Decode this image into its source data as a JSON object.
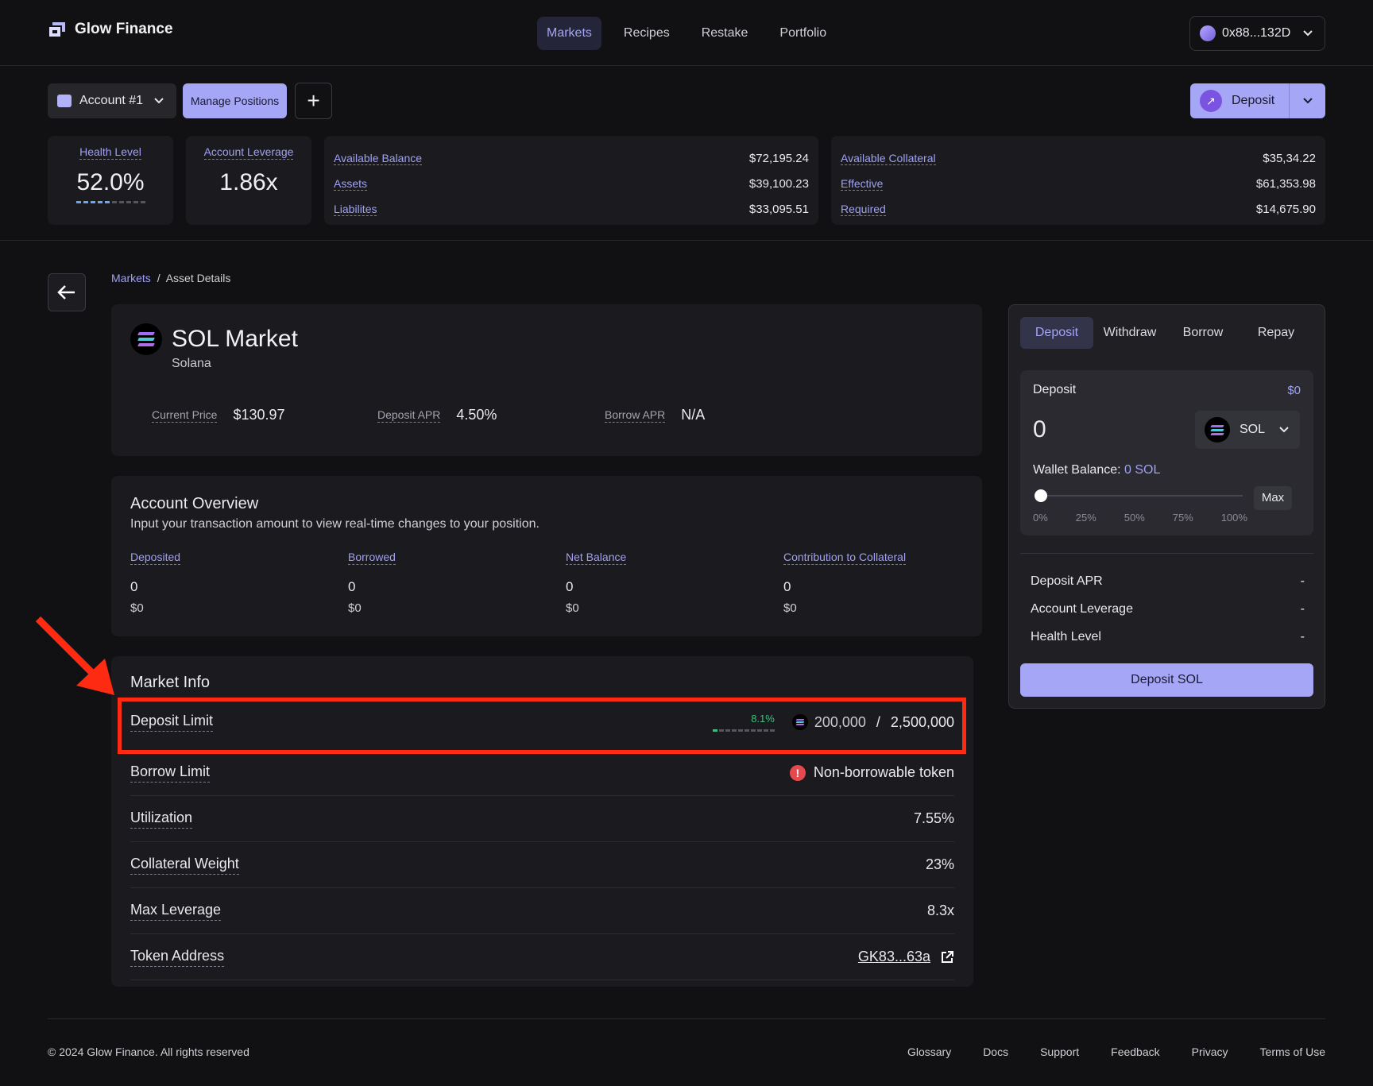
{
  "brand": {
    "name": "Glow Finance"
  },
  "nav": {
    "items": [
      {
        "label": "Markets",
        "active": true
      },
      {
        "label": "Recipes",
        "active": false
      },
      {
        "label": "Restake",
        "active": false
      },
      {
        "label": "Portfolio",
        "active": false
      }
    ]
  },
  "wallet": {
    "address": "0x88...132D"
  },
  "account": {
    "selector_label": "Account #1",
    "manage_label": "Manage Positions",
    "deposit_label": "Deposit"
  },
  "stats": {
    "health_label": "Health Level",
    "health_value": "52.0%",
    "health_fraction": 0.52,
    "leverage_label": "Account Leverage",
    "leverage_value": "1.86x"
  },
  "balances": {
    "available_balance_label": "Available Balance",
    "available_balance_value": "$72,195.24",
    "assets_label": "Assets",
    "assets_value": "$39,100.23",
    "liabilities_label": "Liabilites",
    "liabilities_value": "$33,095.51",
    "available_collateral_label": "Available Collateral",
    "available_collateral_value": "$35,34.22",
    "effective_label": "Effective",
    "effective_value": "$61,353.98",
    "required_label": "Required",
    "required_value": "$14,675.90"
  },
  "breadcrumb": {
    "root": "Markets",
    "sep": "/",
    "current": "Asset Details"
  },
  "market": {
    "title": "SOL Market",
    "subtitle": "Solana",
    "current_price_label": "Current Price",
    "current_price_value": "$130.97",
    "deposit_apr_label": "Deposit APR",
    "deposit_apr_value": "4.50%",
    "borrow_apr_label": "Borrow APR",
    "borrow_apr_value": "N/A"
  },
  "overview": {
    "title": "Account Overview",
    "description": "Input your transaction amount to view real-time changes to your position.",
    "columns": [
      {
        "label": "Deposited",
        "amount": "0",
        "usd": "$0"
      },
      {
        "label": "Borrowed",
        "amount": "0",
        "usd": "$0"
      },
      {
        "label": "Net Balance",
        "amount": "0",
        "usd": "$0"
      },
      {
        "label": "Contribution to Collateral",
        "amount": "0",
        "usd": "$0"
      }
    ]
  },
  "market_info": {
    "title": "Market Info",
    "deposit_limit_label": "Deposit Limit",
    "deposit_limit_pct": "8.1%",
    "deposit_limit_fraction": 0.081,
    "deposit_limit_used": "200,000",
    "deposit_limit_sep": " / ",
    "deposit_limit_total": "2,500,000",
    "borrow_limit_label": "Borrow Limit",
    "borrow_limit_value": "Non-borrowable token",
    "utilization_label": "Utilization",
    "utilization_value": "7.55%",
    "collateral_weight_label": "Collateral Weight",
    "collateral_weight_value": "23%",
    "max_leverage_label": "Max Leverage",
    "max_leverage_value": "8.3x",
    "token_address_label": "Token Address",
    "token_address_value": "GK83...63a"
  },
  "panel": {
    "tabs": [
      {
        "label": "Deposit",
        "active": true
      },
      {
        "label": "Withdraw",
        "active": false
      },
      {
        "label": "Borrow",
        "active": false
      },
      {
        "label": "Repay",
        "active": false
      }
    ],
    "input_label": "Deposit",
    "input_usd": "$0",
    "input_value": "0",
    "token": "SOL",
    "wallet_balance_label": "Wallet Balance:",
    "wallet_balance_value": "0 SOL",
    "slider_fraction": 0,
    "percents": [
      "0%",
      "25%",
      "50%",
      "75%",
      "100%"
    ],
    "max_label": "Max",
    "deposit_apr_label": "Deposit APR",
    "deposit_apr_value": "-",
    "account_leverage_label": "Account Leverage",
    "account_leverage_value": "-",
    "health_level_label": "Health Level",
    "health_level_value": "-",
    "cta_label": "Deposit SOL"
  },
  "footer": {
    "copyright": "© 2024 Glow Finance. All rights reserved",
    "links": [
      "Glossary",
      "Docs",
      "Support",
      "Feedback",
      "Privacy",
      "Terms of Use"
    ]
  },
  "colors": {
    "accent": "#a5a6f5",
    "link": "#9fa0f5",
    "annotation": "#ff2a12",
    "positive": "#3fbf7f",
    "warning": "#e5484d"
  },
  "icons": [
    "glow-logo-icon",
    "chevron-down-icon",
    "plus-icon",
    "arrow-left-icon",
    "solana-icon",
    "alert-icon",
    "external-link-icon",
    "deposit-arrow-icon",
    "red-annotation-arrow"
  ]
}
